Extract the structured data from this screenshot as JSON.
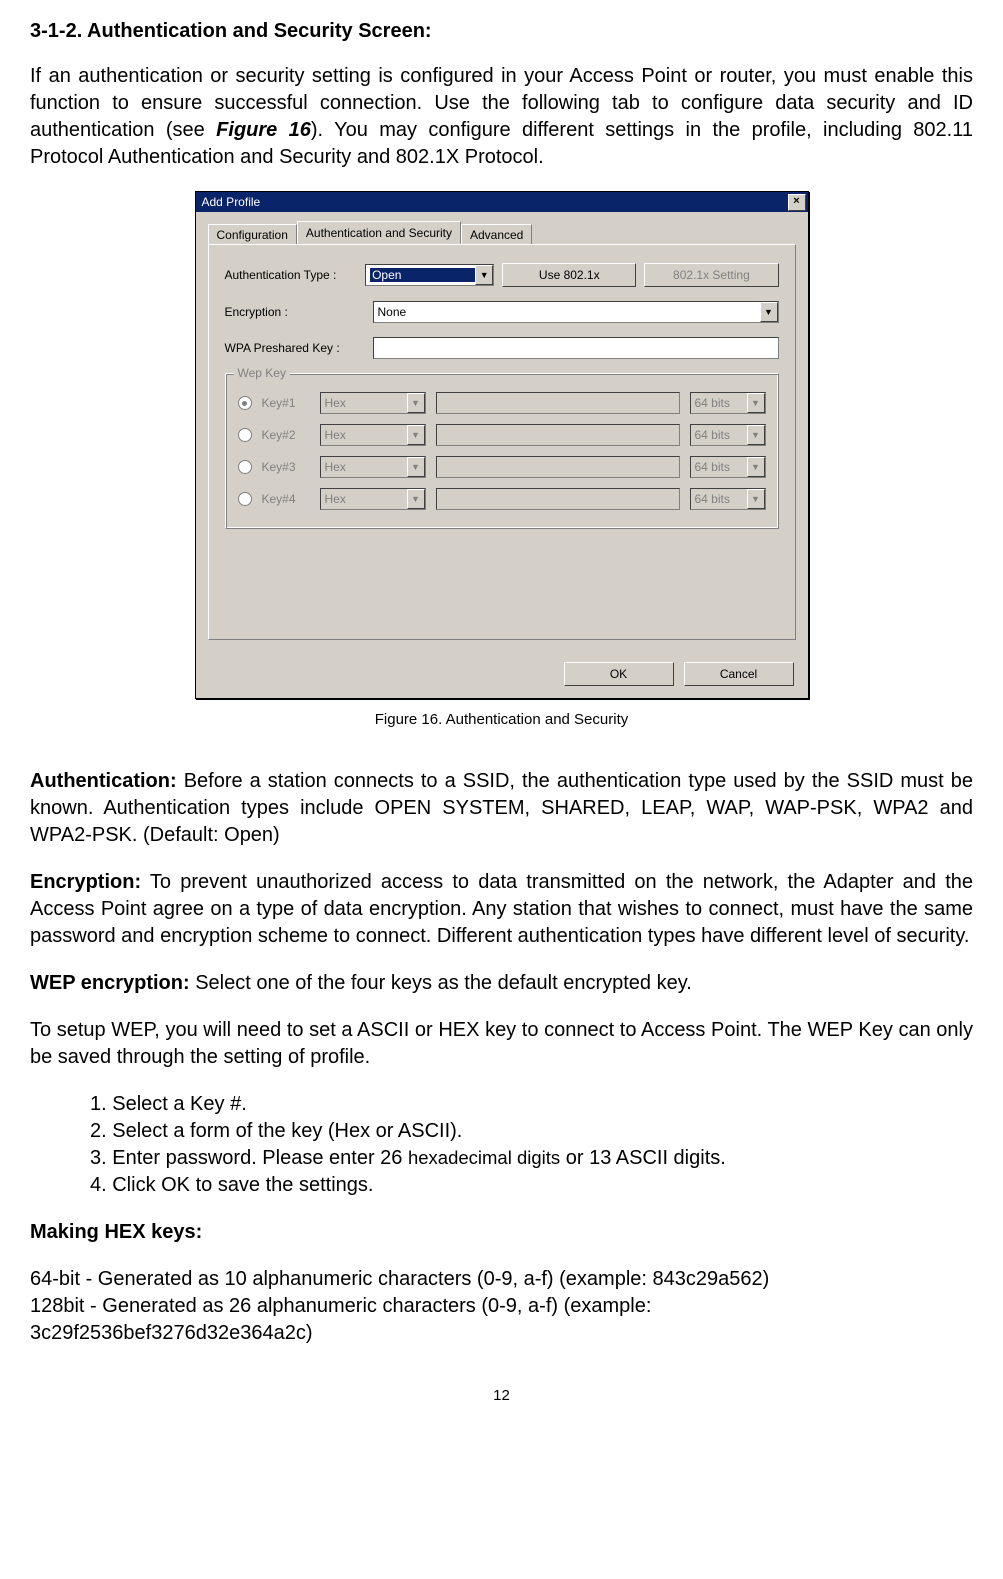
{
  "heading": "3-1-2. Authentication and Security Screen:",
  "intro_pre": "If an authentication or security setting is configured in your Access Point or router, you must enable this function to ensure successful connection. Use the following tab to configure data security and ID authentication (see ",
  "intro_figref": "Figure 16",
  "intro_post": "). You may configure different settings in the profile, including 802.11 Protocol Authentication and Security and 802.1X Protocol.",
  "dialog": {
    "title": "Add Profile",
    "close": "×",
    "tabs": {
      "configuration": "Configuration",
      "auth": "Authentication and Security",
      "advanced": "Advanced"
    },
    "labels": {
      "auth_type": "Authentication Type :",
      "encryption": "Encryption :",
      "wpa_psk": "WPA Preshared Key :",
      "wep_group": "Wep Key"
    },
    "auth_type_value": "Open",
    "use_8021x_btn": "Use 802.1x",
    "setting_8021x_btn": "802.1x Setting",
    "encryption_value": "None",
    "wep": [
      {
        "label": "Key#1",
        "format": "Hex",
        "bits": "64 bits",
        "selected": true
      },
      {
        "label": "Key#2",
        "format": "Hex",
        "bits": "64 bits",
        "selected": false
      },
      {
        "label": "Key#3",
        "format": "Hex",
        "bits": "64 bits",
        "selected": false
      },
      {
        "label": "Key#4",
        "format": "Hex",
        "bits": "64 bits",
        "selected": false
      }
    ],
    "ok": "OK",
    "cancel": "Cancel"
  },
  "figure_caption": "Figure 16.    Authentication and Security",
  "sections": {
    "auth_label": "Authentication:",
    "auth_text": "    Before a station connects to a SSID, the authentication type used by the SSID must be known. Authentication types include OPEN SYSTEM, SHARED, LEAP, WAP, WAP-PSK, WPA2 and WPA2-PSK. (Default: Open)",
    "enc_label": "Encryption:",
    "enc_text": "    To prevent unauthorized access to data transmitted on the network, the Adapter and the Access Point agree on a type of data encryption. Any station that wishes to connect, must have the same password and encryption scheme to connect. Different authentication types have different level of security.",
    "wep_label": "WEP encryption:",
    "wep_text": "    Select one of the four keys as the default encrypted key.",
    "wep_setup": "To setup WEP, you will need to set a ASCII or HEX key to connect to Access Point. The WEP Key can only be saved through the setting of profile.",
    "steps": {
      "s1": "1. Select a Key #.",
      "s2": "2. Select a form of the key (Hex or ASCII).",
      "s3_pre": "3. Enter password. Please enter 26 ",
      "s3_mid": "hexadecimal digits",
      "s3_post": " or 13 ASCII digits.",
      "s4": "4. Click OK to save the settings."
    },
    "hex_label": "Making HEX keys:",
    "hex_64": "64-bit - Generated as 10 alphanumeric characters (0-9, a-f) (example: 843c29a562)",
    "hex_128a": "128bit - Generated as 26 alphanumeric characters (0-9, a-f) (example:",
    "hex_128b": "3c29f2536bef3276d32e364a2c)"
  },
  "page_number": "12"
}
